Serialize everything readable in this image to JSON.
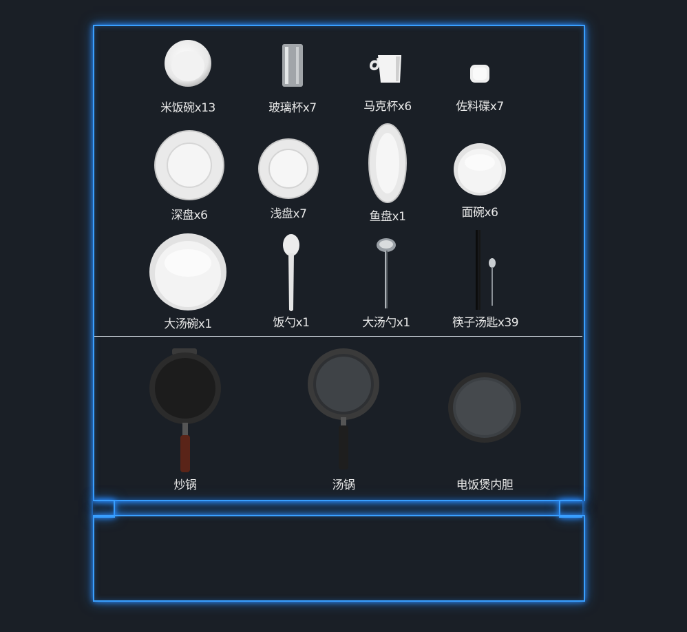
{
  "tableware": [
    {
      "label": "米饭碗x13",
      "icon": "rice-bowl"
    },
    {
      "label": "玻璃杯x7",
      "icon": "glass"
    },
    {
      "label": "马克杯x6",
      "icon": "mug"
    },
    {
      "label": "佐料碟x7",
      "icon": "condiment-dish"
    },
    {
      "label": "深盘x6",
      "icon": "deep-plate"
    },
    {
      "label": "浅盘x7",
      "icon": "shallow-plate"
    },
    {
      "label": "鱼盘x1",
      "icon": "fish-plate"
    },
    {
      "label": "面碗x6",
      "icon": "noodle-bowl"
    },
    {
      "label": "大汤碗x1",
      "icon": "large-soup-bowl"
    },
    {
      "label": "饭勺x1",
      "icon": "rice-spoon"
    },
    {
      "label": "大汤勺x1",
      "icon": "ladle"
    },
    {
      "label": "筷子汤匙x39",
      "icon": "chopsticks-spoon"
    }
  ],
  "cookware": [
    {
      "label": "炒锅",
      "icon": "wok"
    },
    {
      "label": "汤锅",
      "icon": "soup-pot"
    },
    {
      "label": "电饭煲内胆",
      "icon": "rice-cooker-inner-pot"
    }
  ],
  "colors": {
    "glow": "#3aa0ff",
    "background": "#1a1f26",
    "label": "#e8e8e8"
  }
}
